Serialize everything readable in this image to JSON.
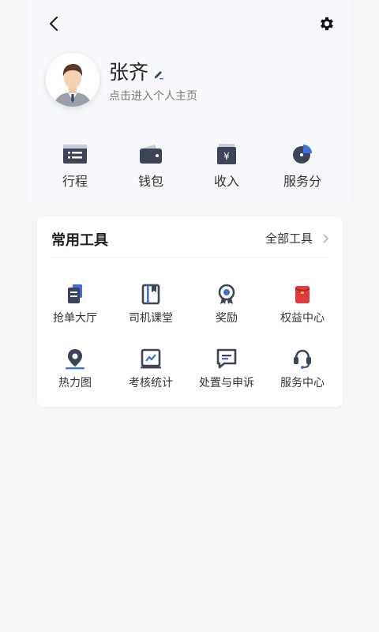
{
  "header": {
    "back_icon": "chevron-left-icon",
    "settings_icon": "gear-icon"
  },
  "profile": {
    "name": "张齐",
    "subtitle": "点击进入个人主页"
  },
  "quick_actions": [
    {
      "label": "行程",
      "icon": "itinerary-icon"
    },
    {
      "label": "钱包",
      "icon": "wallet-icon"
    },
    {
      "label": "收入",
      "icon": "income-icon"
    },
    {
      "label": "服务分",
      "icon": "pie-chart-icon"
    }
  ],
  "tools": {
    "title": "常用工具",
    "all_label": "全部工具",
    "items": [
      {
        "label": "抢单大厅",
        "icon": "order-hall-icon"
      },
      {
        "label": "司机课堂",
        "icon": "book-icon"
      },
      {
        "label": "奖励",
        "icon": "medal-icon"
      },
      {
        "label": "权益中心",
        "icon": "red-envelope-icon"
      },
      {
        "label": "热力图",
        "icon": "location-pin-icon"
      },
      {
        "label": "考核统计",
        "icon": "trend-chart-icon"
      },
      {
        "label": "处置与申诉",
        "icon": "message-icon"
      },
      {
        "label": "服务中心",
        "icon": "headset-icon"
      }
    ]
  },
  "colors": {
    "icon_dark": "#3b4459",
    "accent_blue": "#3e6fe0",
    "accent_red": "#e03a3e",
    "page_bg": "#f6f6f7",
    "panel_bg": "#f7f8fb"
  }
}
